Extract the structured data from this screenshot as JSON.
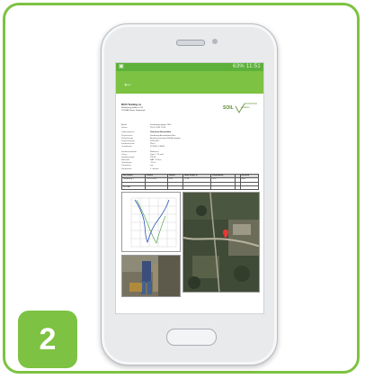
{
  "step": {
    "number": "2"
  },
  "statusbar": {
    "time": "11:51",
    "battery": "63%"
  },
  "appbar": {
    "back_icon": "back-arrow-icon"
  },
  "report": {
    "company": "DUO Testing sv",
    "address1": "Bedrijfsweg address 123",
    "address2": "1234 AB Plaats, Nederland",
    "logo_text": "SOIL",
    "logo_sub": "systems",
    "meta": [
      {
        "k": "Artikel",
        "v": "Sonderingsrapport 2016"
      },
      {
        "k": "Datum",
        "v": "25-11-2016 11:39"
      },
      {
        "k": "",
        "v": ""
      },
      {
        "k": "Opdrachtgever",
        "v": "Gemeente Amsterdam",
        "bold": true
      },
      {
        "k": "Projectnaam",
        "v": "Sondering Amsterdamse Bos"
      },
      {
        "k": "Projectlocatie",
        "v": "Amstelveenseweg 264 Amsterdam"
      },
      {
        "k": "Projectnummer",
        "v": "2016-0417"
      },
      {
        "k": "Sondeerlocatie",
        "v": "Plot 4"
      },
      {
        "k": "Coordinaten",
        "v": "52.3402, 4.8469"
      },
      {
        "k": "",
        "v": ""
      },
      {
        "k": "Sondeermethode",
        "v": "Elektrisch"
      },
      {
        "k": "Conus",
        "v": "Type 1, 15 cm2"
      },
      {
        "k": "Sondeerwagen",
        "v": "TW-01"
      },
      {
        "k": "Maaiveld",
        "v": "NAP -1.20 m"
      },
      {
        "k": "Grondwater",
        "v": "-1.8 m"
      },
      {
        "k": "Voorboring",
        "v": "nee"
      },
      {
        "k": "Sondeerder",
        "v": "J. Jansen"
      }
    ],
    "table": {
      "headers": [
        "Nr/ locatie",
        "Datum",
        "Diepte",
        "Start diepte m",
        "Eindwaarde",
        "",
        "Eenheid"
      ],
      "rows": [
        [
          "Sondering 1",
          "25-11-2016",
          "18.5",
          "-1.20",
          "32.0",
          "",
          "MPa"
        ],
        [
          "",
          "",
          "",
          "",
          "",
          "",
          ""
        ],
        [
          "Ref NAP",
          "",
          "",
          "",
          "",
          "",
          ""
        ]
      ]
    }
  }
}
